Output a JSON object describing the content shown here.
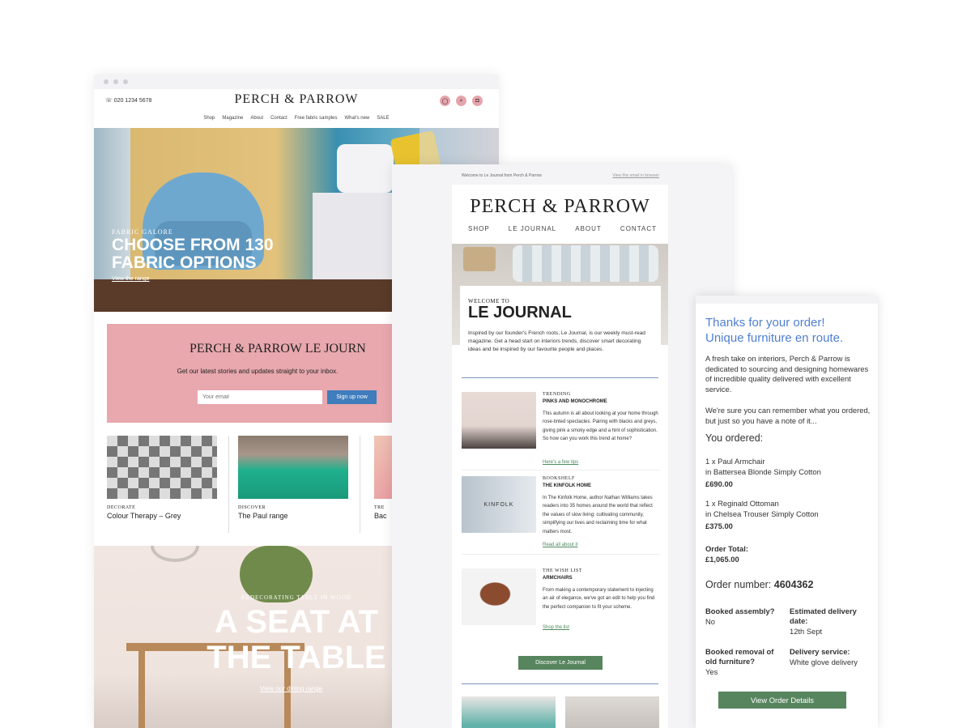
{
  "site": {
    "phone": "020 1234 5678",
    "logo": "PERCH & PARROW",
    "nav": [
      "Shop",
      "Magazine",
      "About",
      "Contact",
      "Free fabric samples",
      "What's new",
      "SALE"
    ],
    "hero": {
      "kicker": "FABRIC GALORE",
      "headline_1": "CHOOSE FROM 130",
      "headline_2": "FABRIC OPTIONS",
      "link": "View the range"
    },
    "signup": {
      "logo": "PERCH & PARROW LE JOURN",
      "message": "Get our latest stories and updates straight to your inbox.",
      "placeholder": "Your email",
      "button": "Sign up now"
    },
    "cards": [
      {
        "tag": "DECORATE",
        "title": "Colour Therapy – Grey"
      },
      {
        "tag": "DISCOVER",
        "title": "The Paul range"
      },
      {
        "tag": "TRE",
        "title": "Bac"
      }
    ],
    "banner": {
      "kicker": "REDECORATING TABLE IN WOOD",
      "headline_1": "A SEAT AT",
      "headline_2": "THE TABLE",
      "link": "View our dining range"
    }
  },
  "journal": {
    "preheader": "Welcome to Le Journal from Perch & Parrow",
    "view_online": "View this email in browser",
    "logo": "PERCH & PARROW",
    "nav": [
      "SHOP",
      "LE JOURNAL",
      "ABOUT",
      "CONTACT"
    ],
    "welcome": {
      "kicker": "WELCOME TO",
      "title": "LE JOURNAL",
      "body": "Inspired by our founder's French roots, Le Journal, is our weekly must-read magazine. Get a head start on interiors trends, discover smart decorating ideas and be inspired by our favourite people and places."
    },
    "items": [
      {
        "kicker": "TRENDING",
        "title": "PINKS AND MONOCHROME",
        "body": "This autumn is all about looking at your home through rose-tinted spectacles. Pairing with blacks and greys, giving pink a smoky edge and a hint of sophistication. So how can you work this trend at home?",
        "link": "Here's a few tips"
      },
      {
        "kicker": "BOOKSHELF",
        "title": "THE KINFOLK HOME",
        "body": "In The Kinfolk Home, author Nathan Williams takes readers into 35 homes around the world that reflect the values of slow living: cultivating community, simplifying our lives and reclaiming time for what matters most.",
        "link": "Read all about it"
      },
      {
        "kicker": "THE WISH LIST",
        "title": "ARMCHAIRS",
        "body": "From making a contemporary statement to injecting an air of elegance, we've got an edit to help you find the perfect companion to fit your scheme.",
        "link": "Shop the list"
      }
    ],
    "book_label": "KINFOLK",
    "cta": "Discover Le Journal"
  },
  "order": {
    "heading_1": "Thanks for your order!",
    "heading_2": "Unique furniture en route.",
    "intro": "A fresh take on interiors, Perch & Parrow is dedicated to sourcing and designing homewares of incredible quality delivered with excellent service.",
    "note": "We're sure you can remember what you ordered, but just so you have a note of it...",
    "you_ordered": "You ordered:",
    "items": [
      {
        "name": "1 x Paul Armchair",
        "variant": "in Battersea Blonde Simply Cotton",
        "price": "£690.00"
      },
      {
        "name": "1 x Reginald Ottoman",
        "variant": "in Chelsea Trouser Simply Cotton",
        "price": "£375.00"
      }
    ],
    "total_label": "Order Total:",
    "total": "£1,065.00",
    "number_label": "Order number:",
    "number": "4604362",
    "assembly_label": "Booked assembly?",
    "assembly": "No",
    "delivery_date_label": "Estimated delivery date:",
    "delivery_date": "12th Sept",
    "removal_label": "Booked removal of old furniture?",
    "removal": "Yes",
    "service_label": "Delivery service:",
    "service": "White glove delivery",
    "button": "View Order Details"
  }
}
